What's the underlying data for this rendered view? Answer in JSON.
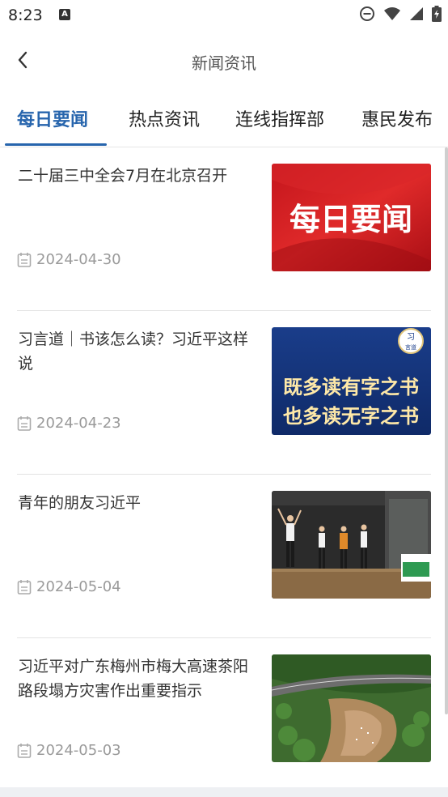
{
  "status_bar": {
    "time": "8:23",
    "a_badge": "A",
    "icons": [
      "dnd-icon",
      "wifi-icon",
      "signal-icon",
      "battery-icon"
    ]
  },
  "header": {
    "title": "新闻资讯",
    "back_icon": "chevron-left-icon"
  },
  "tabs": [
    {
      "label": "每日要闻",
      "active": true
    },
    {
      "label": "热点资讯",
      "active": false
    },
    {
      "label": "连线指挥部",
      "active": false
    },
    {
      "label": "惠民发布",
      "active": false
    }
  ],
  "accent_color": "#2765ad",
  "news": [
    {
      "title": "二十届三中全会7月在北京召开",
      "date": "2024-04-30",
      "thumb_text": "每日要闻"
    },
    {
      "title": "习言道｜书该怎么读？习近平这样说",
      "date": "2024-04-23",
      "thumb_text": {
        "line1": "既多读有字之书",
        "line2": "也多读无字之书",
        "badge_line1": "习",
        "badge_line2": "言道"
      }
    },
    {
      "title": "青年的朋友习近平",
      "date": "2024-05-04",
      "thumb_text": ""
    },
    {
      "title": "习近平对广东梅州市梅大高速茶阳路段塌方灾害作出重要指示",
      "date": "2024-05-03",
      "thumb_text": ""
    }
  ]
}
